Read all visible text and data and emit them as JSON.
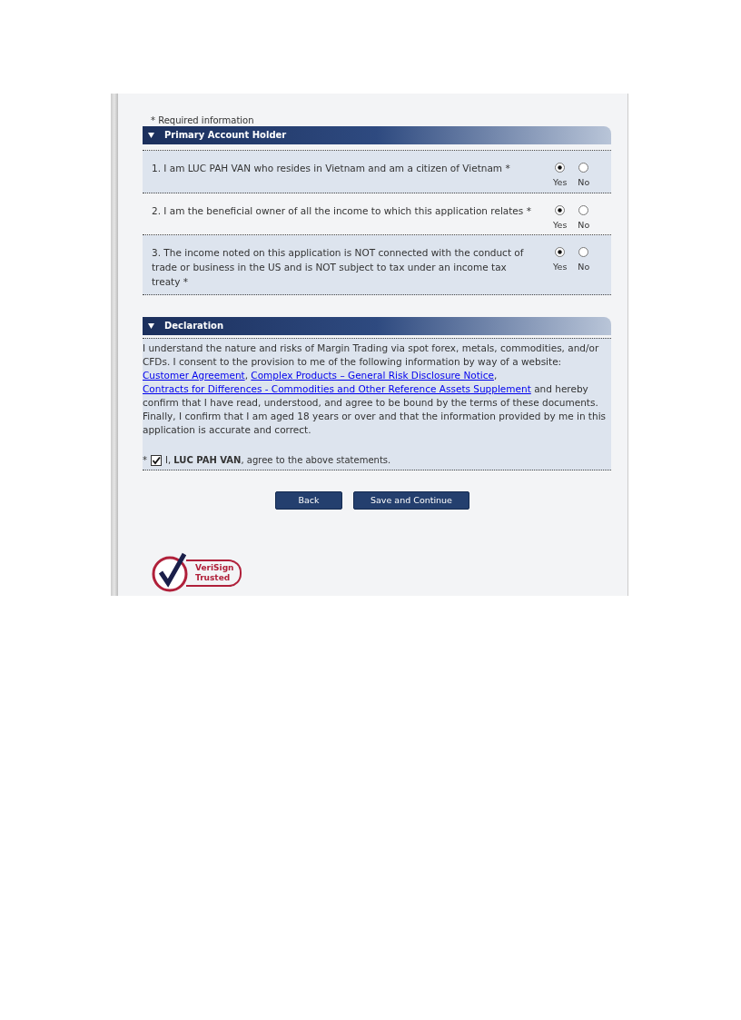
{
  "required_note": "* Required information",
  "primary_section": {
    "title": "Primary Account Holder",
    "expanded": true,
    "questions": [
      {
        "text": "1. I am  LUC PAH VAN who resides in Vietnam and am a citizen of  Vietnam *",
        "options": [
          {
            "label": "Yes",
            "selected": true
          },
          {
            "label": "No",
            "selected": false
          }
        ]
      },
      {
        "text": "2. I am the beneficial owner of all the income to which this application relates *",
        "options": [
          {
            "label": "Yes",
            "selected": true
          },
          {
            "label": "No",
            "selected": false
          }
        ]
      },
      {
        "text": "3. The income noted on this application is NOT connected with the conduct of trade or business in the US and is NOT subject to tax under an income tax treaty   *",
        "options": [
          {
            "label": "Yes",
            "selected": true
          },
          {
            "label": "No",
            "selected": false
          }
        ]
      }
    ]
  },
  "declaration_section": {
    "title": "Declaration",
    "expanded": true,
    "paragraph": [
      {
        "kind": "text",
        "text": "I understand the nature and risks of Margin Trading via spot forex, metals, commodities, and/or CFDs. I consent to the provision to me of the following information by way of a website: "
      },
      {
        "kind": "link",
        "text": "Customer Agreement"
      },
      {
        "kind": "text",
        "text": ",  "
      },
      {
        "kind": "link",
        "text": "Complex Products – General Risk Disclosure Notice"
      },
      {
        "kind": "text",
        "text": ", "
      },
      {
        "kind": "link",
        "text": "Contracts for Differences - Commodities and Other Reference Assets Supplement"
      },
      {
        "kind": "text",
        "text": " and hereby confirm that I have read, understood, and agree to be bound by the terms of these documents. Finally, I confirm that I am aged 18 years or over and that the information provided by me in this application is accurate and correct."
      }
    ],
    "agree": {
      "marker": "*",
      "checked": true,
      "text": "I, **LUC PAH VAN**, agree to the above statements."
    }
  },
  "buttons": [
    "Back",
    "Save and Continue"
  ],
  "badge": {
    "line1": "VeriSign",
    "line2": "Trusted"
  }
}
